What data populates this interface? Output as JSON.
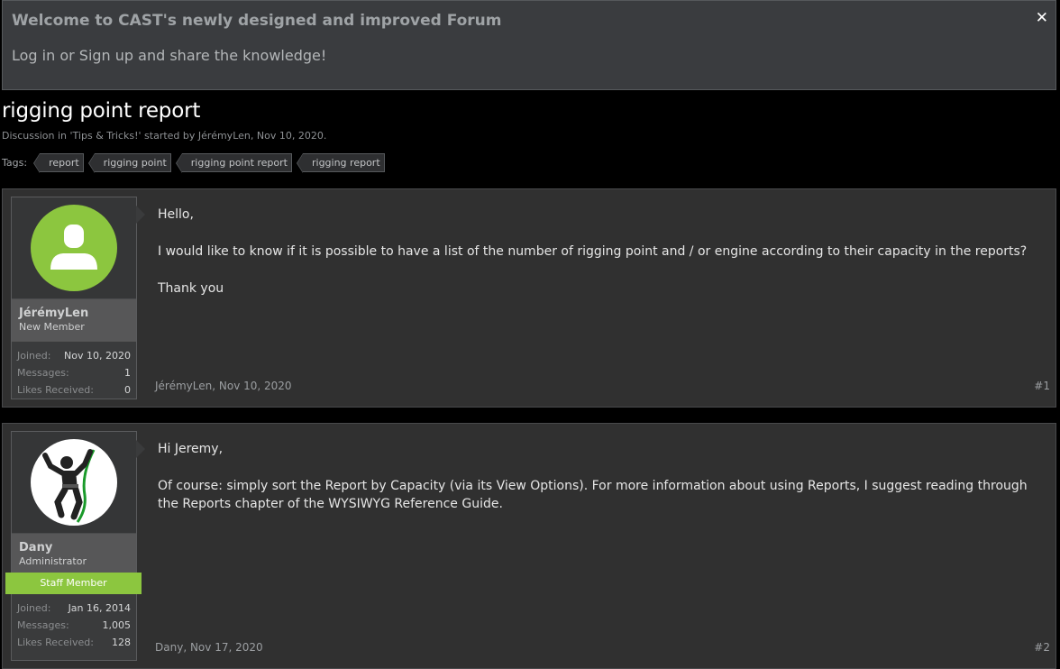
{
  "notice": {
    "title": "Welcome to CAST's newly designed and improved Forum",
    "text": "Log in or Sign up and share the knowledge!",
    "close_glyph": "✕"
  },
  "thread": {
    "title": "rigging point report",
    "meta_prefix": "Discussion in ",
    "forum": "'Tips & Tricks!'",
    "started_by": " started by ",
    "author": "JérémyLen",
    "date_sep": ", ",
    "date": "Nov 10, 2020",
    "end": "."
  },
  "tags": {
    "label": "Tags:",
    "items": [
      "report",
      "rigging point",
      "rigging point report",
      "rigging report"
    ]
  },
  "posts": [
    {
      "username": "JérémyLen",
      "usertitle": "New Member",
      "avatar_icon": "default-user-icon",
      "avatar_color": "#8cc63f",
      "stats": {
        "joined_label": "Joined:",
        "joined": "Nov 10, 2020",
        "messages_label": "Messages:",
        "messages": "1",
        "likes_label": "Likes Received:",
        "likes": "0"
      },
      "paragraphs": [
        "Hello,",
        "I would like to know if it is possible to have a list of the number of rigging point and / or engine according to their capacity in the reports?",
        "Thank you"
      ],
      "footer_author": "JérémyLen",
      "footer_date": "Nov 10, 2020",
      "post_number": "#1"
    },
    {
      "username": "Dany",
      "usertitle": "Administrator",
      "staff_banner": "Staff Member",
      "avatar_icon": "climber-icon",
      "stats": {
        "joined_label": "Joined:",
        "joined": "Jan 16, 2014",
        "messages_label": "Messages:",
        "messages": "1,005",
        "likes_label": "Likes Received:",
        "likes": "128"
      },
      "paragraphs": [
        "Hi Jeremy,",
        "Of course: simply sort the Report by Capacity (via its View Options). For more information about using Reports, I suggest reading through the Reports chapter of the WYSIWYG Reference Guide."
      ],
      "footer_author": "Dany",
      "footer_date": "Nov 17, 2020",
      "post_number": "#2"
    }
  ],
  "colors": {
    "accent_green": "#8cc63f",
    "background": "#000000",
    "post_bg": "#303030"
  }
}
